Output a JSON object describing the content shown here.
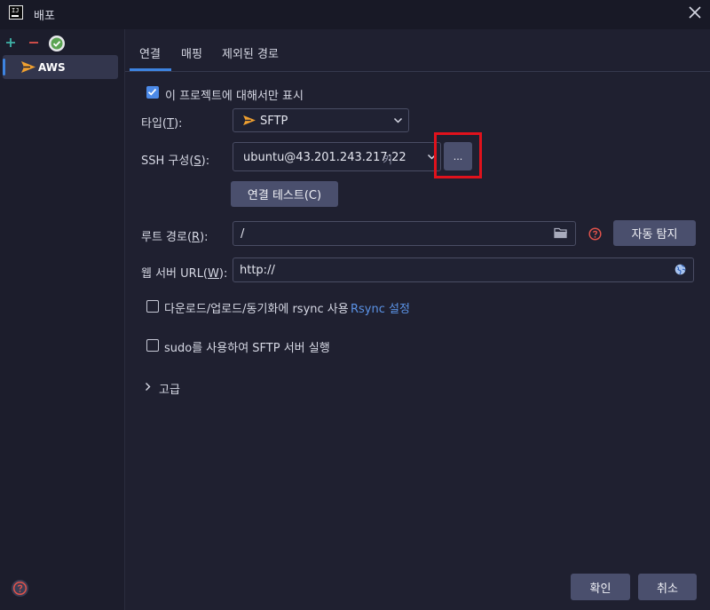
{
  "window": {
    "title": "배포",
    "icon": "intellij-app-icon",
    "close_icon": "close-icon"
  },
  "toolbar": {
    "add_icon": "plus-icon",
    "remove_icon": "minus-icon",
    "default_icon": "checkmark-circle-icon"
  },
  "servers": [
    {
      "label": "AWS",
      "icon": "sftp-send-icon",
      "selected": true
    }
  ],
  "tabs": [
    {
      "label": "연결",
      "active": true
    },
    {
      "label": "매핑",
      "active": false
    },
    {
      "label": "제외된 경로",
      "active": false
    }
  ],
  "connection": {
    "visible_only_this_project": {
      "label": "이 프로젝트에 대해서만 표시",
      "checked": true
    },
    "type": {
      "label": "타입(",
      "mnemonic": "T",
      "label_end": "):",
      "value": "SFTP"
    },
    "ssh_config": {
      "label": "SSH 구성(",
      "mnemonic": "S",
      "label_end": "):",
      "value": "ubuntu@43.201.243.217:22",
      "hint": "키",
      "browse_label": "..."
    },
    "test_connection_label": "연결 테스트(C)",
    "root_path": {
      "label": "루트 경로(",
      "mnemonic": "R",
      "label_end": "):",
      "value": "/",
      "autodetect_label": "자동 탐지"
    },
    "web_server_url": {
      "label": "웹 서버 URL(",
      "mnemonic": "W",
      "label_end": "):",
      "value": "http://"
    },
    "rsync": {
      "label": "다운로드/업로드/동기화에 rsync 사용",
      "checked": false,
      "settings_link": "Rsync 설정"
    },
    "sudo": {
      "label": "sudo를 사용하여 SFTP 서버 실행",
      "checked": false
    },
    "advanced_label": "고급"
  },
  "footer": {
    "ok_label": "확인",
    "cancel_label": "취소",
    "help_icon": "help-icon"
  },
  "colors": {
    "accent": "#3d83e0",
    "highlight": "#e0121c",
    "sftp_orange": "#f0a030"
  }
}
